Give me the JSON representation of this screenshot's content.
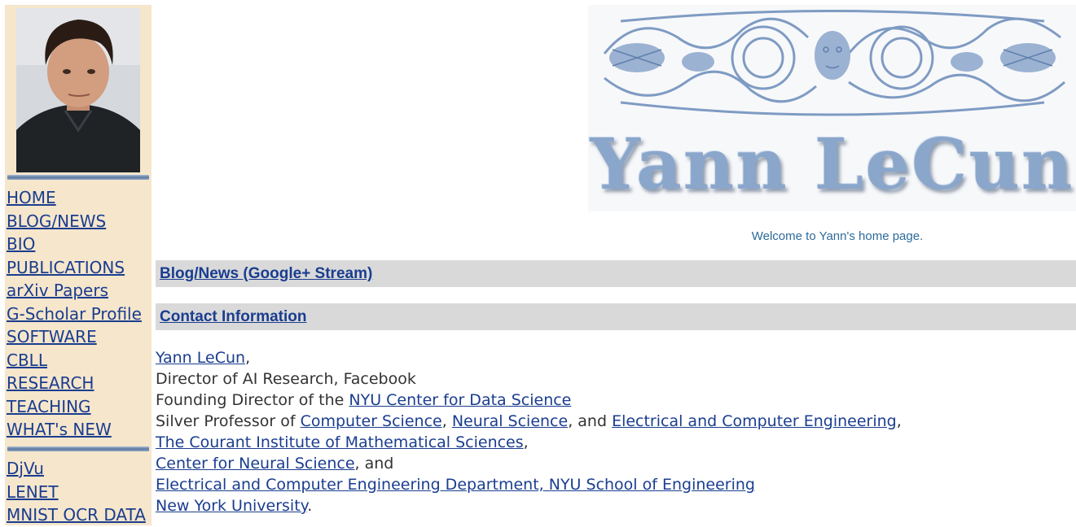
{
  "sidebar": {
    "nav": [
      "HOME",
      "BLOG/NEWS",
      "BIO",
      "PUBLICATIONS",
      "arXiv Papers",
      "G-Scholar Profile",
      "SOFTWARE",
      "CBLL",
      "RESEARCH",
      "TEACHING",
      "WHAT's NEW"
    ],
    "nav2": [
      "DjVu",
      "LENET",
      "MNIST OCR DATA"
    ]
  },
  "banner": {
    "title": "Yann LeCun"
  },
  "welcome": "Welcome to Yann's home page.",
  "sections": {
    "blog": "Blog/News (Google+ Stream)",
    "contact": "Contact Information"
  },
  "contact": {
    "name": "Yann LeCun",
    "comma": ",",
    "role1": "Director of AI Research, Facebook",
    "role2_prefix": "Founding Director of the ",
    "role2_link": "NYU Center for Data Science",
    "role3_prefix": "Silver Professor of ",
    "cs": "Computer Science",
    "sep": ", ",
    "ns": "Neural Science",
    "and": ", and ",
    "ece": "Electrical and Computer Engineering",
    "trail_comma": ",",
    "courant": "The Courant Institute of Mathematical Sciences",
    "cns": "Center for Neural Science",
    "cns_suffix": ", and",
    "ece_dept": "Electrical and Computer Engineering Department, NYU School of Engineering",
    "nyu": "New York University",
    "period": "."
  }
}
